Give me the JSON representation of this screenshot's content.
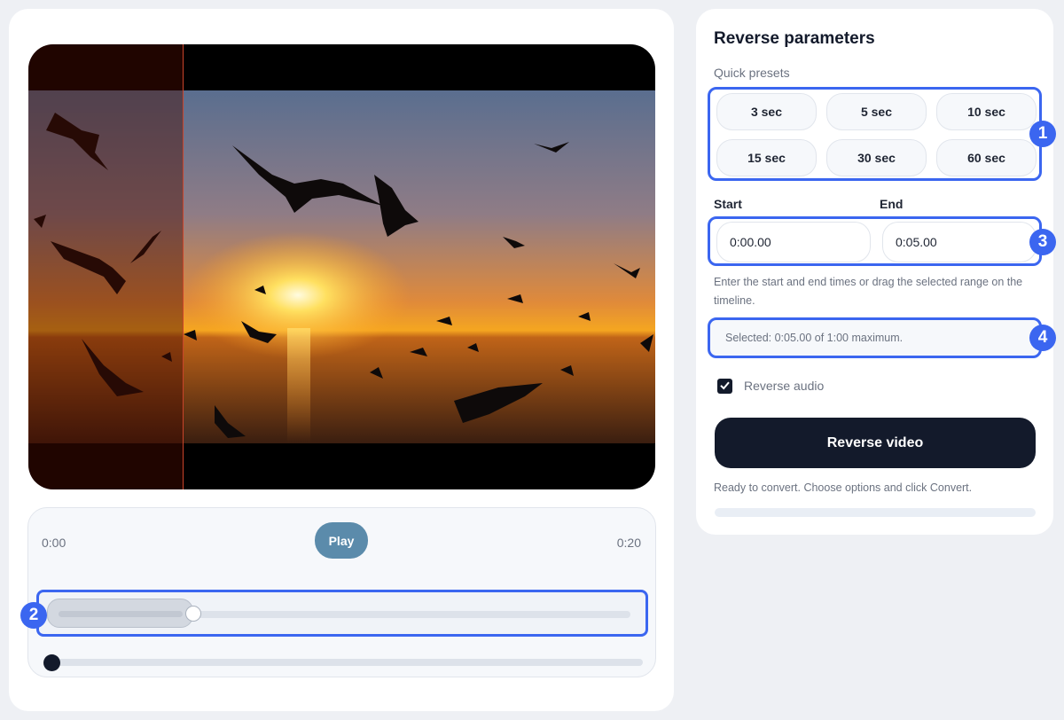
{
  "player": {
    "time_start": "0:00",
    "time_end": "0:20",
    "play_label": "Play",
    "selection_fraction": 0.25,
    "playhead_fraction": 0.0
  },
  "panel": {
    "title": "Reverse parameters",
    "presets_label": "Quick presets",
    "presets": [
      "3 sec",
      "5 sec",
      "10 sec",
      "15 sec",
      "30 sec",
      "60 sec"
    ],
    "start_label": "Start",
    "end_label": "End",
    "start_value": "0:00.00",
    "end_value": "0:05.00",
    "help_text": "Enter the start and end times or drag the selected range on the timeline.",
    "selected_text": "Selected: 0:05.00 of 1:00 maximum.",
    "reverse_audio_label": "Reverse audio",
    "reverse_audio_checked": true,
    "reverse_button": "Reverse video",
    "status_text": "Ready to convert. Choose options and click Convert.",
    "progress": 0
  },
  "badges": [
    "1",
    "2",
    "3",
    "4"
  ],
  "colors": {
    "accent": "#3b66f0",
    "primary_button": "#131a2b",
    "play_button": "#5b8bab"
  },
  "icons": {
    "checkbox": "check-icon",
    "video": "sunset-birds-frame"
  }
}
